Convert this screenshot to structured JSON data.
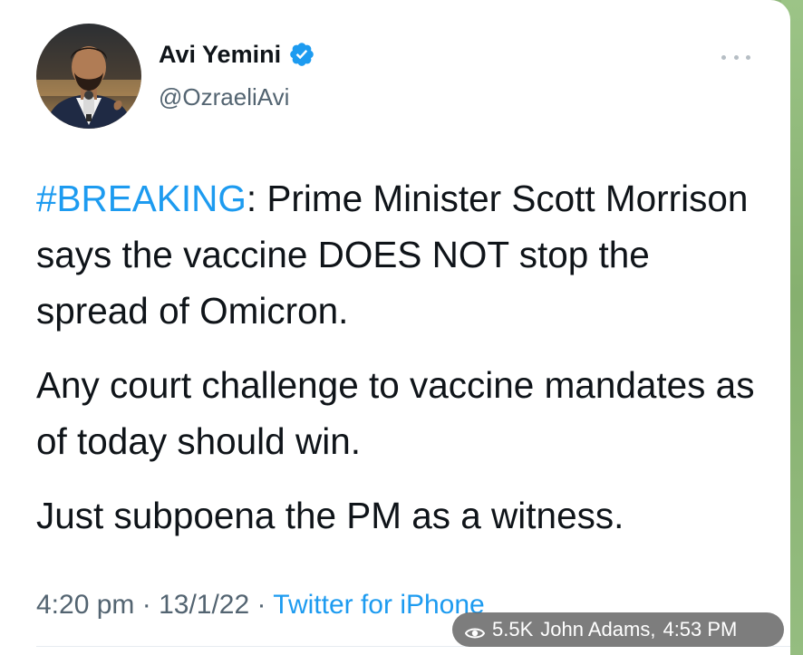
{
  "user": {
    "display_name": "Avi Yemini",
    "handle": "@OzraeliAvi",
    "verified_icon": "verified-badge-icon",
    "avatar": "profile-photo"
  },
  "tweet": {
    "hashtag": "#BREAKING",
    "line1_rest": ": Prime Minister Scott Morrison says the vaccine DOES NOT stop the spread of Omicron.",
    "paragraph2": "Any court challenge to vaccine mandates as of today should win.",
    "paragraph3": "Just subpoena the PM as a witness."
  },
  "meta": {
    "time": "4:20 pm",
    "separator": " · ",
    "date": "13/1/22",
    "source": "Twitter for iPhone"
  },
  "overlay": {
    "views": "5.5K",
    "author": "John Adams,",
    "time": "4:53 PM",
    "icon": "eye-icon"
  },
  "colors": {
    "link_blue": "#1d9bf0",
    "text": "#0f1419",
    "muted": "#536471",
    "background_green": "#8fb77a"
  }
}
